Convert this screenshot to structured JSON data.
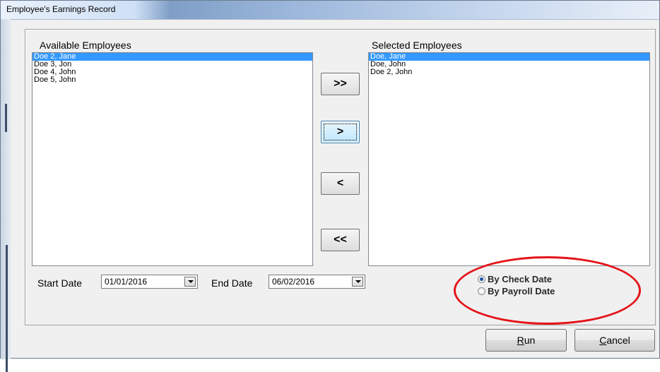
{
  "window": {
    "title": "Employee's Earnings Record"
  },
  "available": {
    "label": "Available Employees",
    "items": [
      "Doe 2, Jane",
      "Doe 3, Jon",
      "Doe 4, John",
      "Doe 5, John"
    ],
    "selected_index": 0
  },
  "selected": {
    "label": "Selected Employees",
    "items": [
      "Doe, Jane",
      "Doe, John",
      "Doe 2, John"
    ],
    "selected_index": 0
  },
  "transfer_buttons": {
    "add_all": ">>",
    "add_one": ">",
    "remove_one": "<",
    "remove_all": "<<"
  },
  "dates": {
    "start_label": "Start Date",
    "start_value": "01/01/2016",
    "end_label": "End Date",
    "end_value": "06/02/2016"
  },
  "date_mode": {
    "options": [
      "By Check Date",
      "By Payroll Date"
    ],
    "selected": "By Check Date"
  },
  "actions": {
    "run_mnemonic": "R",
    "run_rest": "un",
    "cancel_mnemonic": "C",
    "cancel_rest": "ancel"
  },
  "colors": {
    "selection": "#3399ff",
    "highlight_oval": "#e4141a",
    "window_bg": "#f0f0f0"
  }
}
